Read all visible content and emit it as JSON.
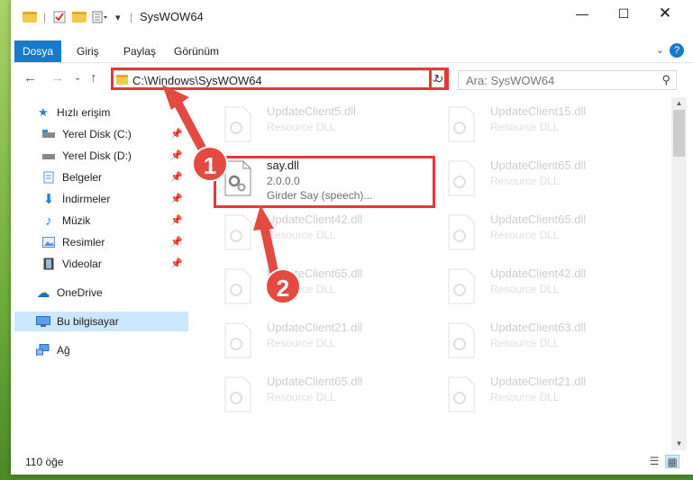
{
  "window": {
    "title": "SysWOW64"
  },
  "ribbon": {
    "tabs": [
      {
        "label": "Dosya"
      },
      {
        "label": "Giriş"
      },
      {
        "label": "Paylaş"
      },
      {
        "label": "Görünüm"
      }
    ],
    "help": "?"
  },
  "address": {
    "path": "C:\\Windows\\SysWOW64"
  },
  "search": {
    "placeholder": "Ara: SysWOW64"
  },
  "sidebar": {
    "items": [
      {
        "label": "Hızlı erişim"
      },
      {
        "label": "Yerel Disk (C:)"
      },
      {
        "label": "Yerel Disk (D:)"
      },
      {
        "label": "Belgeler"
      },
      {
        "label": "İndirmeler"
      },
      {
        "label": "Müzik"
      },
      {
        "label": "Resimler"
      },
      {
        "label": "Videolar"
      },
      {
        "label": "OneDrive"
      },
      {
        "label": "Bu bilgisayar"
      },
      {
        "label": "Ağ"
      }
    ]
  },
  "files": {
    "highlighted": {
      "name": "say.dll",
      "version": "2.0.0.0",
      "description": "Girder Say (speech)..."
    },
    "left": [
      {
        "name": "UpdateClient5.dll",
        "type": "Resource DLL"
      },
      {
        "name": "UpdateClient42.dll",
        "type": "Resource DLL"
      },
      {
        "name": "UpdateClient65.dll",
        "type": "Resource DLL"
      },
      {
        "name": "UpdateClient21.dll",
        "type": "Resource DLL"
      },
      {
        "name": "UpdateClient65.dll",
        "type": "Resource DLL"
      }
    ],
    "right": [
      {
        "name": "UpdateClient15.dll",
        "type": "Resource DLL"
      },
      {
        "name": "UpdateClient65.dll",
        "type": "Resource DLL"
      },
      {
        "name": "UpdateClient65.dll",
        "type": "Resource DLL"
      },
      {
        "name": "UpdateClient42.dll",
        "type": "Resource DLL"
      },
      {
        "name": "UpdateClient63.dll",
        "type": "Resource DLL"
      },
      {
        "name": "UpdateClient21.dll",
        "type": "Resource DLL"
      }
    ]
  },
  "status": {
    "count": "110 öğe"
  },
  "annotations": {
    "step1": "1",
    "step2": "2"
  },
  "colors": {
    "accent": "#1979ca",
    "highlight": "#e03a3a",
    "selection": "#cce8ff"
  }
}
